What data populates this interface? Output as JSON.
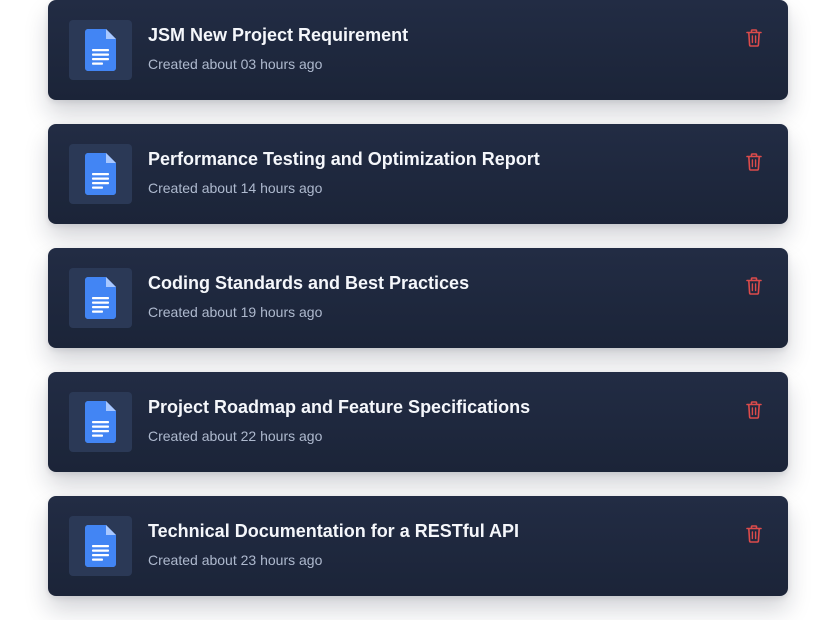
{
  "documents": [
    {
      "title": "JSM New Project Requirement",
      "created": "Created about 03 hours ago",
      "icon": "google-doc-icon",
      "action_icon": "trash-icon"
    },
    {
      "title": "Performance Testing and Optimization Report",
      "created": "Created about 14 hours ago",
      "icon": "google-doc-icon",
      "action_icon": "trash-icon"
    },
    {
      "title": "Coding Standards and Best Practices",
      "created": "Created about 19 hours ago",
      "icon": "google-doc-icon",
      "action_icon": "trash-icon"
    },
    {
      "title": "Project Roadmap and Feature Specifications",
      "created": "Created about 22 hours ago",
      "icon": "google-doc-icon",
      "action_icon": "trash-icon"
    },
    {
      "title": "Technical Documentation for a RESTful API",
      "created": "Created about 23 hours ago",
      "icon": "google-doc-icon",
      "action_icon": "trash-icon"
    }
  ],
  "colors": {
    "card_background": "#1f2940",
    "icon_tile": "#2b3956",
    "document_blue": "#4285f4",
    "delete_red": "#dc4b4b",
    "title_text": "#f5f7fb",
    "meta_text": "#aeb9ce"
  }
}
